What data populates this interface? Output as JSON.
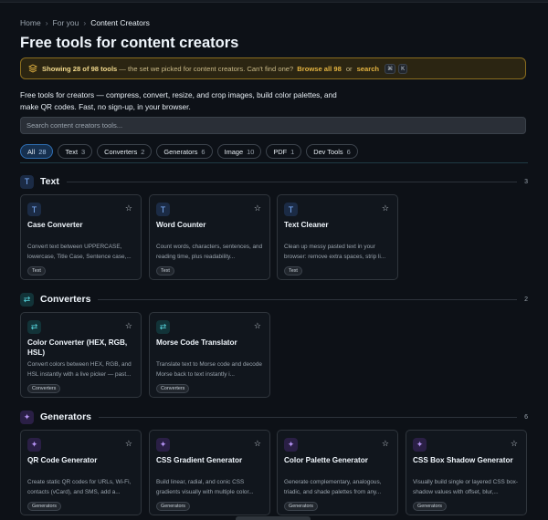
{
  "breadcrumb": [
    "Home",
    "For you",
    "Content Creators"
  ],
  "page_title": "Free tools for content creators",
  "banner": {
    "showing": "Showing 28 of 98 tools",
    "rest": " — the set we picked for content creators. Can't find one?",
    "browse_all": "Browse all 98",
    "or": "or",
    "search": "search",
    "kbd1": "⌘",
    "kbd2": "K"
  },
  "intro": "Free tools for creators — compress, convert, resize, and crop images, build color palettes, and make QR codes. Fast, no sign-up, in your browser.",
  "search_placeholder": "Search content creators tools...",
  "chips": [
    {
      "label": "All",
      "count": "28"
    },
    {
      "label": "Text",
      "count": "3"
    },
    {
      "label": "Converters",
      "count": "2"
    },
    {
      "label": "Generators",
      "count": "6"
    },
    {
      "label": "Image",
      "count": "10"
    },
    {
      "label": "PDF",
      "count": "1"
    },
    {
      "label": "Dev Tools",
      "count": "6"
    }
  ],
  "sections": [
    {
      "name": "Text",
      "count": "3"
    },
    {
      "name": "Converters",
      "count": "2"
    },
    {
      "name": "Generators",
      "count": "6"
    }
  ],
  "cards": {
    "text": [
      {
        "name": "Case Converter",
        "desc": "Convert text between UPPERCASE, lowercase, Title Case, Sentence case,...",
        "tag": "Text"
      },
      {
        "name": "Word Counter",
        "desc": "Count words, characters, sentences, and reading time, plus readability...",
        "tag": "Text"
      },
      {
        "name": "Text Cleaner",
        "desc": "Clean up messy pasted text in your browser: remove extra spaces, strip li...",
        "tag": "Text"
      }
    ],
    "converters": [
      {
        "name": "Color Converter (HEX, RGB, HSL)",
        "desc": "Convert colors between HEX, RGB, and HSL instantly with a live picker — past...",
        "tag": "Converters"
      },
      {
        "name": "Morse Code Translator",
        "desc": "Translate text to Morse code and decode Morse back to text instantly i...",
        "tag": "Converters"
      }
    ],
    "generators": [
      {
        "name": "QR Code Generator",
        "desc": "Create static QR codes for URLs, Wi-Fi, contacts (vCard), and SMS, add a...",
        "tag": "Generators"
      },
      {
        "name": "CSS Gradient Generator",
        "desc": "Build linear, radial, and conic CSS gradients visually with multiple color...",
        "tag": "Generators"
      },
      {
        "name": "Color Palette Generator",
        "desc": "Generate complementary, analogous, triadic, and shade palettes from any...",
        "tag": "Generators"
      },
      {
        "name": "CSS Box Shadow Generator",
        "desc": "Visually build single or layered CSS box-shadow values with offset, blur,...",
        "tag": "Generators"
      }
    ]
  }
}
